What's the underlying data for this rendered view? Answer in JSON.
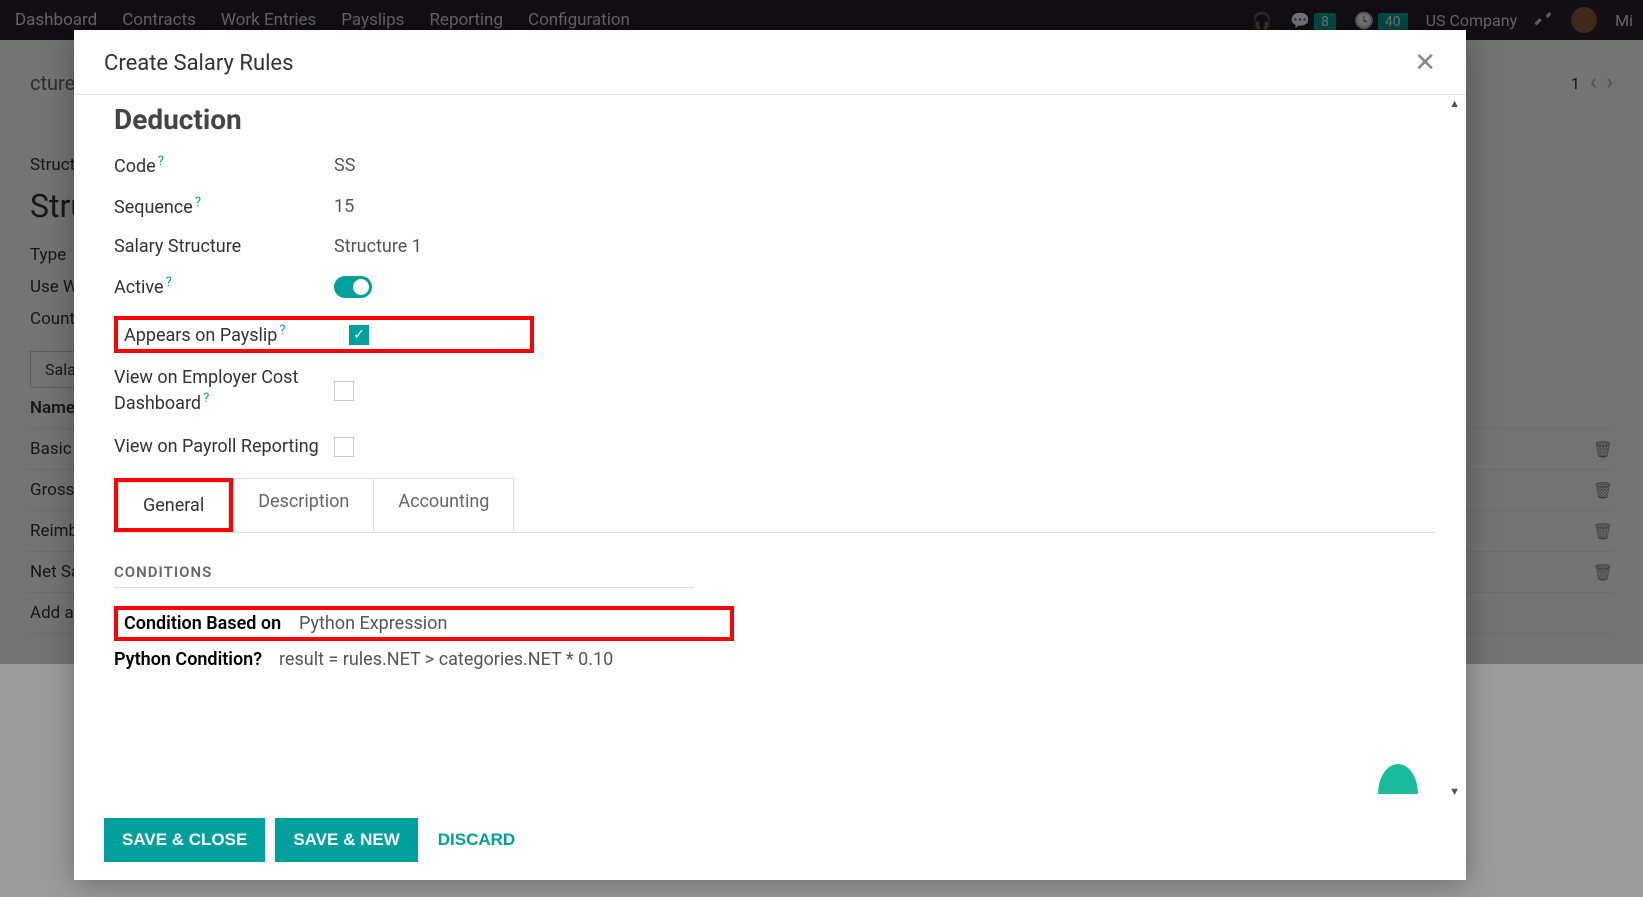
{
  "topbar": {
    "nav": [
      "Dashboard",
      "Contracts",
      "Work Entries",
      "Payslips",
      "Reporting",
      "Configuration"
    ],
    "msg_badge": "8",
    "activity_badge": "40",
    "company": "US Company",
    "user_short": "Mi"
  },
  "background": {
    "breadcrumb_tail": "ctures",
    "title": "Stru",
    "labels": {
      "structures": "Structur",
      "type": "Type",
      "use_worked": "Use Wor",
      "country": "Country"
    },
    "tab": "Salary",
    "table_header": "Name",
    "rows": [
      "Basic Sa",
      "Gross",
      "Reimbur",
      "Net Sala",
      "Add a lin"
    ],
    "pager": "1"
  },
  "modal": {
    "title": "Create Salary Rules",
    "section_title": "Deduction",
    "fields": {
      "code_label": "Code",
      "code_value": "SS",
      "sequence_label": "Sequence",
      "sequence_value": "15",
      "structure_label": "Salary Structure",
      "structure_value": "Structure 1",
      "active_label": "Active",
      "appears_label": "Appears on Payslip",
      "view_cost_label": "View on Employer Cost Dashboard",
      "view_reporting_label": "View on Payroll Reporting"
    },
    "tabs": {
      "general": "General",
      "description": "Description",
      "accounting": "Accounting"
    },
    "conditions": {
      "section": "CONDITIONS",
      "based_label": "Condition Based on",
      "based_value": "Python Expression",
      "python_label": "Python Condition",
      "python_value": "result = rules.NET > categories.NET * 0.10"
    },
    "footer": {
      "save_close": "SAVE & CLOSE",
      "save_new": "SAVE & NEW",
      "discard": "DISCARD"
    }
  }
}
